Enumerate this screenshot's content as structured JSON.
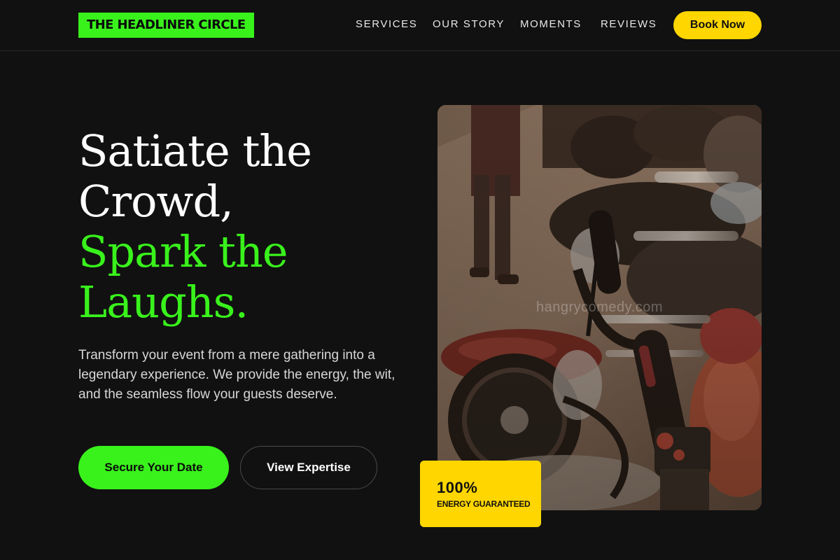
{
  "header": {
    "logo": "THE HEADLINER CIRCLE",
    "nav": [
      {
        "label": "SERVICES"
      },
      {
        "label": "OUR STORY"
      },
      {
        "label": "MOMENTS"
      },
      {
        "label": "REVIEWS"
      }
    ],
    "cta": "Book Now"
  },
  "hero": {
    "title_lines": [
      "Satiate the",
      "Crowd,"
    ],
    "accent_lines": [
      "Spark the",
      "Laughs."
    ],
    "description": "Transform your event from a mere gathering into a legendary experience. We provide the energy, the wit, and the seamless flow your guests deserve.",
    "primary_button": "Secure Your Date",
    "secondary_button": "View Expertise"
  },
  "image": {
    "watermark": "hangrycomedy.com"
  },
  "badge": {
    "value": "100%",
    "label": "ENERGY GUARANTEED"
  },
  "colors": {
    "background": "#111111",
    "accent_green": "#39f21c",
    "accent_yellow": "#ffd600"
  }
}
